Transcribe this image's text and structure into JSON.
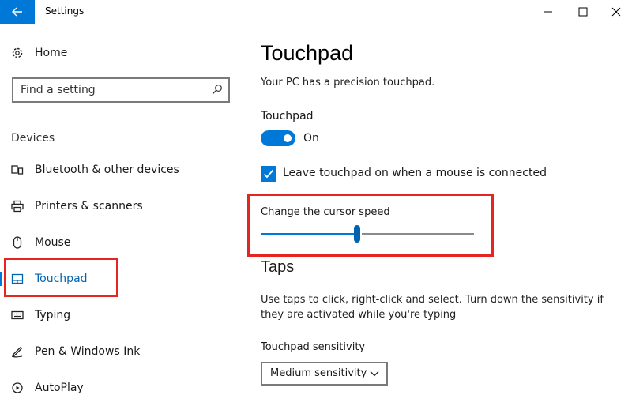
{
  "window": {
    "title": "Settings",
    "controls": [
      "minimize-icon",
      "maximize-icon",
      "close-icon"
    ]
  },
  "sidebar": {
    "home_label": "Home",
    "search_placeholder": "Find a setting",
    "section_label": "Devices",
    "items": [
      {
        "label": "Bluetooth & other devices",
        "icon": "bluetooth-icon"
      },
      {
        "label": "Printers & scanners",
        "icon": "printer-icon"
      },
      {
        "label": "Mouse",
        "icon": "mouse-icon"
      },
      {
        "label": "Touchpad",
        "icon": "touchpad-icon",
        "active": true
      },
      {
        "label": "Typing",
        "icon": "keyboard-icon"
      },
      {
        "label": "Pen & Windows Ink",
        "icon": "pen-icon"
      },
      {
        "label": "AutoPlay",
        "icon": "autoplay-icon"
      }
    ]
  },
  "main": {
    "title": "Touchpad",
    "subtitle": "Your PC has a precision touchpad.",
    "touchpad_label": "Touchpad",
    "toggle_state": "On",
    "checkbox_label": "Leave touchpad on when a mouse is connected",
    "checkbox_checked": true,
    "speed_label": "Change the cursor speed",
    "speed_value": 0.45,
    "taps_heading": "Taps",
    "taps_description": "Use taps to click, right-click and select. Turn down the sensitivity if they are activated while you're typing",
    "sensitivity_label": "Touchpad sensitivity",
    "sensitivity_value": "Medium sensitivity"
  },
  "colors": {
    "accent": "#0078d7",
    "highlight": "#e52522"
  }
}
